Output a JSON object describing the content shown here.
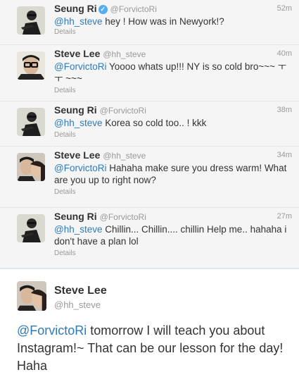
{
  "tweets": [
    {
      "name": "Seung Ri",
      "handle": "@ForvictoRi",
      "verified": true,
      "time": "52m",
      "mention": "@hh_steve",
      "text": " hey ! How was in Newyork!?",
      "details": "Details"
    },
    {
      "name": "Steve Lee",
      "handle": "@hh_steve",
      "verified": false,
      "time": "40m",
      "mention": "@ForvictoRi",
      "text": " Yoooo whats up!!! NY is so cold bro~~~ ㅜㅜ ~~~",
      "details": "Details"
    },
    {
      "name": "Seung Ri",
      "handle": "@ForvictoRi",
      "verified": false,
      "time": "38m",
      "mention": "@hh_steve",
      "text": " Korea so cold too.. ! kkk",
      "details": "Details"
    },
    {
      "name": "Steve Lee",
      "handle": "@hh_steve",
      "verified": false,
      "time": "34m",
      "mention": "@ForvictoRi",
      "text": " Hahaha make sure you dress warm! What are you up to right now?",
      "details": "Details"
    },
    {
      "name": "Seung Ri",
      "handle": "@ForvictoRi",
      "verified": false,
      "time": "27m",
      "mention": "@hh_steve",
      "text": " Chillin... Chillin.... chillin Help me.. hahaha i don't have a plan lol",
      "details": "Details"
    }
  ],
  "focused": {
    "name": "Steve Lee",
    "handle": "@hh_steve",
    "mention": "@ForvictoRi",
    "text": " tomorrow I will teach you about Instagram!~ That can be our lesson for the day! Haha"
  },
  "colors": {
    "link": "#2b7bb9",
    "verified": "#55acee",
    "stripe_bg": "#f5f5f5"
  }
}
